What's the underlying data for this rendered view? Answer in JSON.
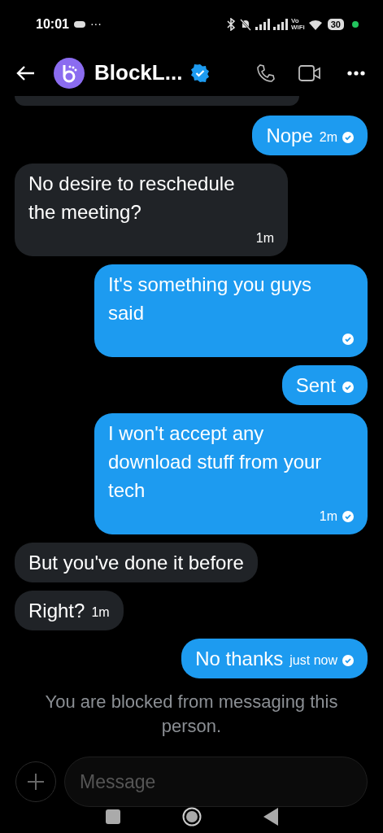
{
  "status_bar": {
    "time": "10:01",
    "dots": "···",
    "vo": "Vo",
    "wifi_label": "WiFi",
    "battery": "30"
  },
  "header": {
    "name": "BlockL...",
    "verified": true
  },
  "messages": [
    {
      "kind": "partial"
    },
    {
      "kind": "sent",
      "text": "Nope",
      "time": "2m",
      "read": true
    },
    {
      "kind": "received",
      "text": "No desire to reschedule the meeting?",
      "time": "1m"
    },
    {
      "kind": "sent",
      "text": "It's something you guys said",
      "read": true
    },
    {
      "kind": "sent",
      "text": "Sent",
      "read": true
    },
    {
      "kind": "sent",
      "text": "I won't accept any download stuff from your tech",
      "time": "1m",
      "read": true
    },
    {
      "kind": "received",
      "text": "But you've done it before"
    },
    {
      "kind": "received",
      "text": "Right?",
      "time": "1m"
    },
    {
      "kind": "sent",
      "text": "No thanks",
      "time": "just now",
      "read": true
    }
  ],
  "notice": "You are blocked from messaging this person.",
  "composer": {
    "placeholder": "Message"
  }
}
